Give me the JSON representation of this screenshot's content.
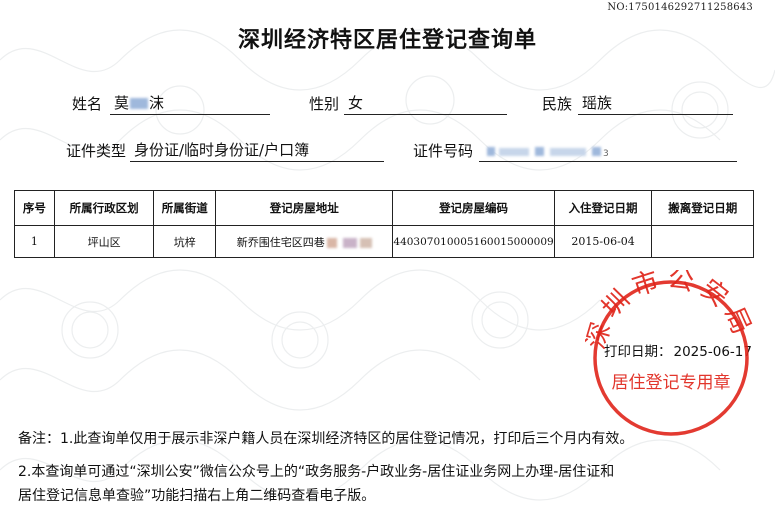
{
  "doc_number": "NO:17501462927112586",
  "doc_number_tail": "43",
  "title": "深圳经济特区居住登记查询单",
  "fields": {
    "name_label": "姓名",
    "name_value_a": "莫",
    "name_value_b": "沫",
    "gender_label": "性别",
    "gender_value": "女",
    "ethnicity_label": "民族",
    "ethnicity_value": "瑶族",
    "id_type_label": "证件类型",
    "id_type_value": "身份证/临时身份证/户口簿",
    "id_number_label": "证件号码",
    "id_number_value": "",
    "id_number_tail": "3"
  },
  "table": {
    "headers": [
      "序号",
      "所属行政区划",
      "所属街道",
      "登记房屋地址",
      "登记房屋编码",
      "入住登记日期",
      "搬离登记日期"
    ],
    "rows": [
      {
        "index": "1",
        "district": "坪山区",
        "street": "坑梓",
        "address": "新乔围住宅区四巷",
        "house_code": "440307010005160015000009",
        "checkin_date": "2015-06-04",
        "checkout_date": ""
      }
    ]
  },
  "print_date_label": "打印日期：",
  "print_date_value": "2025-06-17",
  "stamp": {
    "arc_text": "深圳市公安局",
    "bottom_text": "居住登记专用章",
    "color": "#e0251b"
  },
  "notes": {
    "line1": "备注：1.此查询单仅用于展示非深户籍人员在深圳经济特区的居住登记情况，打印后三个月内有效。",
    "line2": "2.本查询单可通过“深圳公安”微信公众号上的“政务服务-户政业务-居住证业务网上办理-居住证和",
    "line3": "居住登记信息单查验”功能扫描右上角二维码查看电子版。"
  }
}
